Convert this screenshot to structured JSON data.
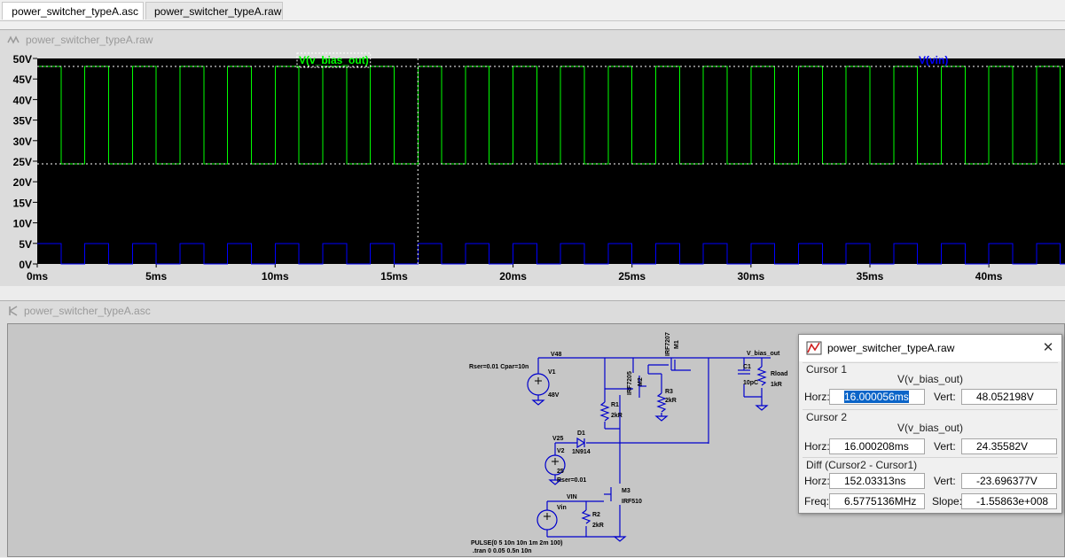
{
  "tabs": [
    {
      "label": "power_switcher_typeA.asc",
      "icon": "schematic-icon",
      "active": true
    },
    {
      "label": "power_switcher_typeA.raw",
      "icon": "waveform-icon",
      "active": false
    }
  ],
  "waveform_pane": {
    "title": "power_switcher_typeA.raw",
    "icon": "waveform-icon"
  },
  "schematic_pane": {
    "title": "power_switcher_typeA.asc",
    "icon": "schematic-icon"
  },
  "chart_data": {
    "type": "line",
    "series": [
      {
        "name": "V(v_bias_out)",
        "color": "#00ff00",
        "low": 24.36,
        "high": 48.05,
        "period_ms": 2,
        "duty": 0.5,
        "starts_high": true
      },
      {
        "name": "V(vin)",
        "color": "#0000ff",
        "low": 0,
        "high": 5,
        "period_ms": 2,
        "duty": 0.5,
        "starts_high": true
      }
    ],
    "x_ticks": [
      "0ms",
      "5ms",
      "10ms",
      "15ms",
      "20ms",
      "25ms",
      "30ms",
      "35ms",
      "40ms"
    ],
    "y_ticks": [
      "0V",
      "5V",
      "10V",
      "15V",
      "20V",
      "25V",
      "30V",
      "35V",
      "40V",
      "45V",
      "50V"
    ],
    "xlim": [
      0,
      43.2
    ],
    "ylim": [
      0,
      50
    ],
    "cursor_x_ms": 16.0,
    "cursor_levels": [
      48.05,
      24.36
    ],
    "background": "#000000",
    "grid": false
  },
  "schematic": {
    "labels": {
      "v48": "V48",
      "rser_cpar": "Rser=0.01 Cpar=10n",
      "v1": "V1",
      "v1_val": "48V",
      "m1_part": "IRF7207",
      "m1": "M1",
      "m2_part": "IRF7205",
      "m2": "M2",
      "r3": "R3",
      "r3_val": "2kR",
      "r1": "R1",
      "r1_val": "2kR",
      "vbias_out": "V_bias_out",
      "c1": "C1",
      "c1_val": "10pC",
      "rload": "Rload",
      "rload_val": "1kR",
      "v25": "V25",
      "d1": "D1",
      "d1_part": "1N914",
      "v2": "V2",
      "v2_val": "25",
      "v2_rser": "Rser=0.01",
      "m3": "M3",
      "m3_part": "IRF510",
      "vin": "VIN",
      "vin_src": "Vin",
      "r2": "R2",
      "r2_val": "2kR",
      "pulse": "PULSE(0 5 10n 10n 1m 2m 100)",
      "tran": ".tran 0 0.05 0.5n 10n"
    }
  },
  "cursor_dialog": {
    "title": "power_switcher_typeA.raw",
    "close": "✕",
    "cursor1": {
      "section": "Cursor 1",
      "signal": "V(v_bias_out)",
      "horz_label": "Horz:",
      "horz": "16.000056ms",
      "vert_label": "Vert:",
      "vert": "48.052198V"
    },
    "cursor2": {
      "section": "Cursor 2",
      "signal": "V(v_bias_out)",
      "horz_label": "Horz:",
      "horz": "16.000208ms",
      "vert_label": "Vert:",
      "vert": "24.35582V"
    },
    "diff": {
      "section": "Diff (Cursor2 - Cursor1)",
      "horz_label": "Horz:",
      "horz": "152.03313ns",
      "vert_label": "Vert:",
      "vert": "-23.696377V",
      "freq_label": "Freq:",
      "freq": "6.5775136MHz",
      "slope_label": "Slope:",
      "slope": "-1.55863e+008"
    }
  }
}
